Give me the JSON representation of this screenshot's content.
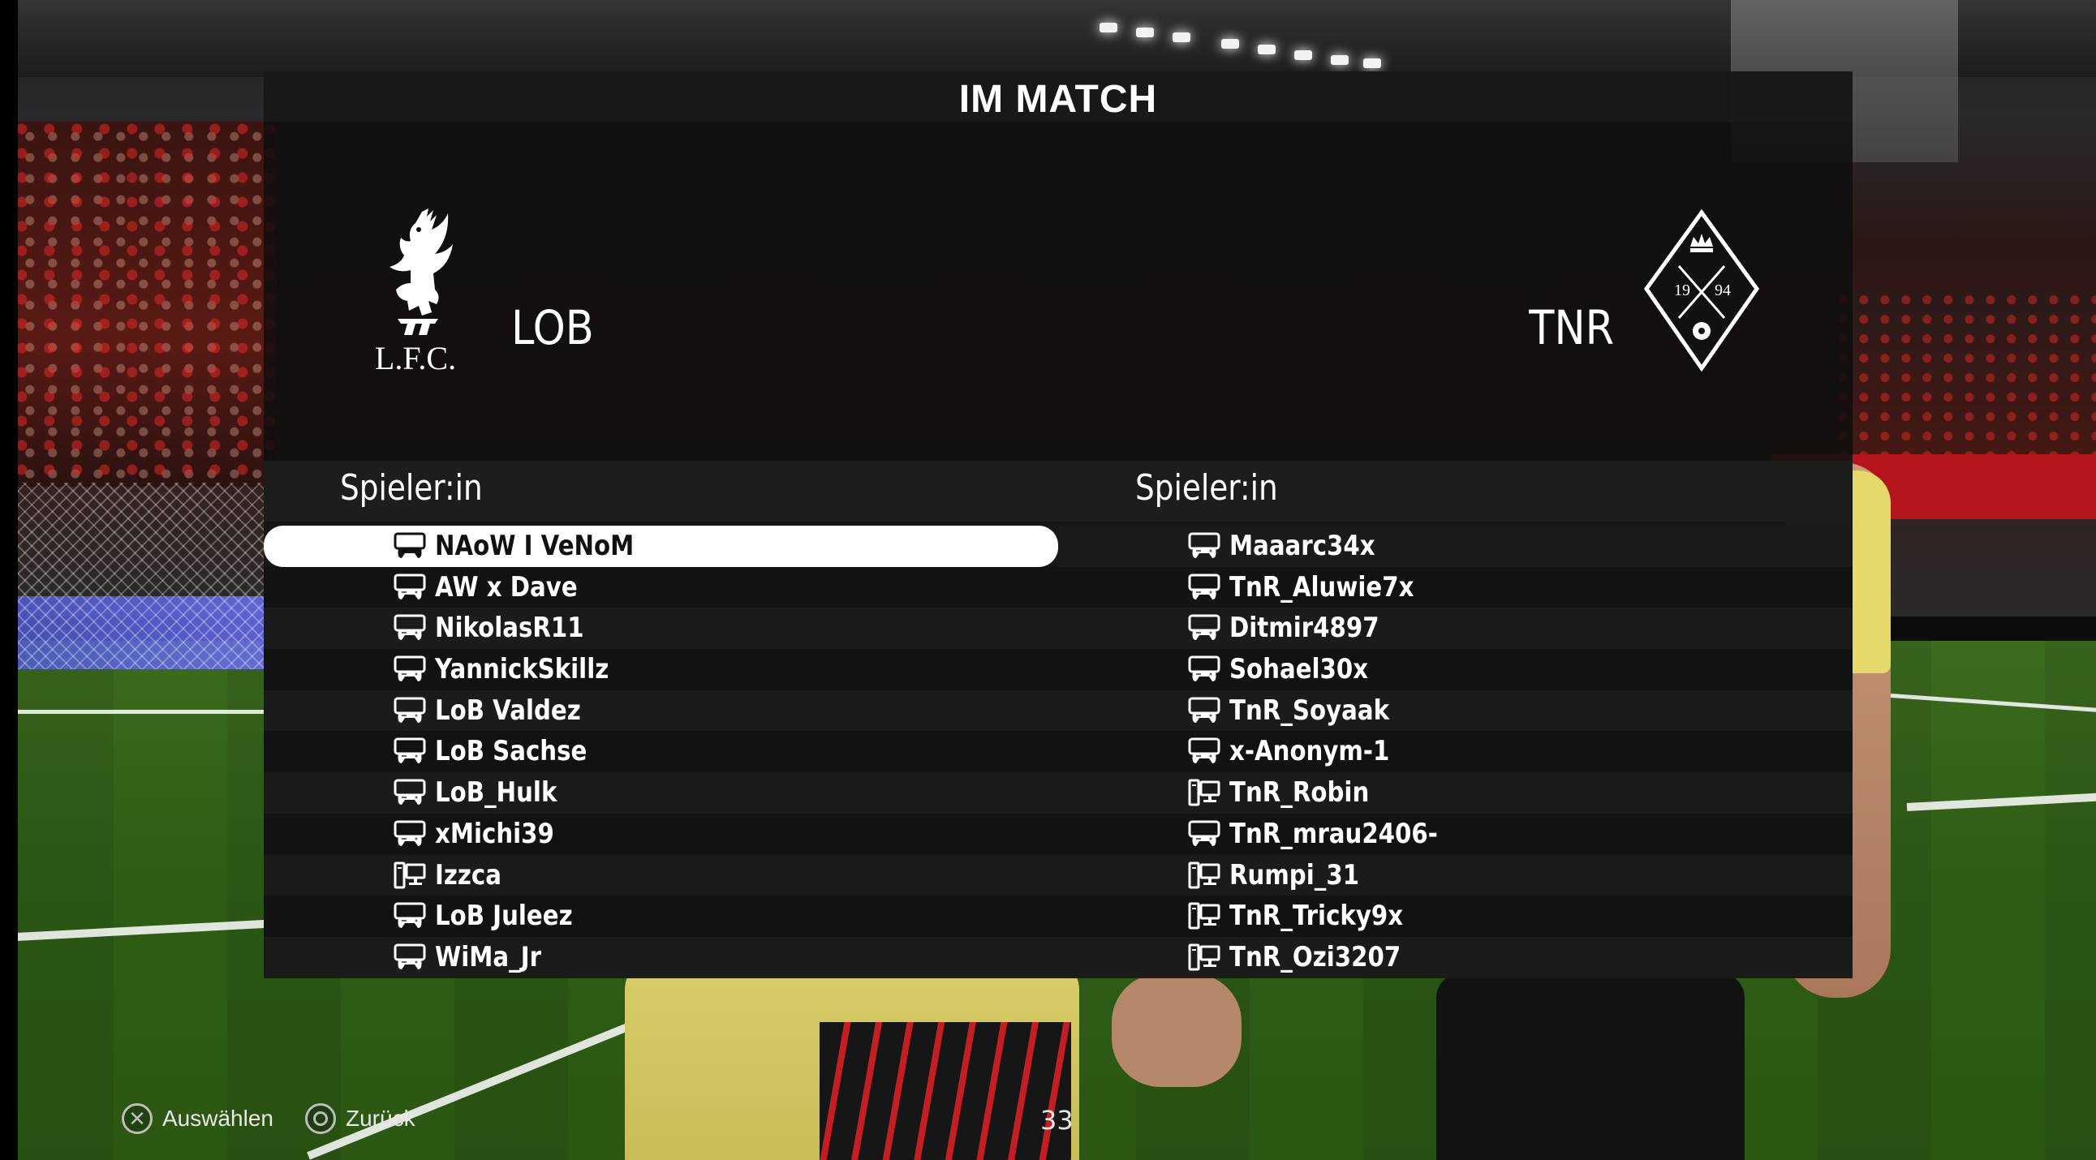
{
  "title": "IM MATCH",
  "home_team": {
    "abbr": "LOB",
    "crest_text": "L.F.C."
  },
  "away_team": {
    "abbr": "TNR",
    "crest_text_left": "19",
    "crest_text_right": "94"
  },
  "columns": {
    "left_header": "Spieler:in",
    "right_header": "Spieler:in"
  },
  "home_players": [
    {
      "name": "NAoW I VeNoM",
      "device": "controller-icon",
      "selected": true
    },
    {
      "name": "AW x Dave",
      "device": "controller-icon"
    },
    {
      "name": "NikolasR11",
      "device": "controller-icon"
    },
    {
      "name": "YannickSkillz",
      "device": "controller-icon"
    },
    {
      "name": "LoB Valdez",
      "device": "controller-icon"
    },
    {
      "name": "LoB Sachse",
      "device": "controller-icon"
    },
    {
      "name": "LoB_Hulk",
      "device": "controller-icon"
    },
    {
      "name": "xMichi39",
      "device": "controller-icon"
    },
    {
      "name": "Izzca",
      "device": "pc-icon"
    },
    {
      "name": "LoB Juleez",
      "device": "controller-icon"
    },
    {
      "name": "WiMa_Jr",
      "device": "controller-icon"
    }
  ],
  "away_players": [
    {
      "name": "Maaarc34x",
      "device": "controller-icon"
    },
    {
      "name": "TnR_Aluwie7x",
      "device": "controller-icon"
    },
    {
      "name": "Ditmir4897",
      "device": "controller-icon"
    },
    {
      "name": "Sohael30x",
      "device": "controller-icon"
    },
    {
      "name": "TnR_Soyaak",
      "device": "controller-icon"
    },
    {
      "name": "x-Anonym-1",
      "device": "controller-icon"
    },
    {
      "name": "TnR_Robin",
      "device": "pc-icon"
    },
    {
      "name": "TnR_mrau2406-",
      "device": "controller-icon"
    },
    {
      "name": "Rumpi_31",
      "device": "pc-icon"
    },
    {
      "name": "TnR_Tricky9x",
      "device": "pc-icon"
    },
    {
      "name": "TnR_Ozi3207",
      "device": "pc-icon"
    }
  ],
  "footer": {
    "select_label": "Auswählen",
    "select_icon": "cross-button-icon",
    "back_label": "Zurück",
    "back_icon": "circle-button-icon",
    "counter": "33"
  }
}
